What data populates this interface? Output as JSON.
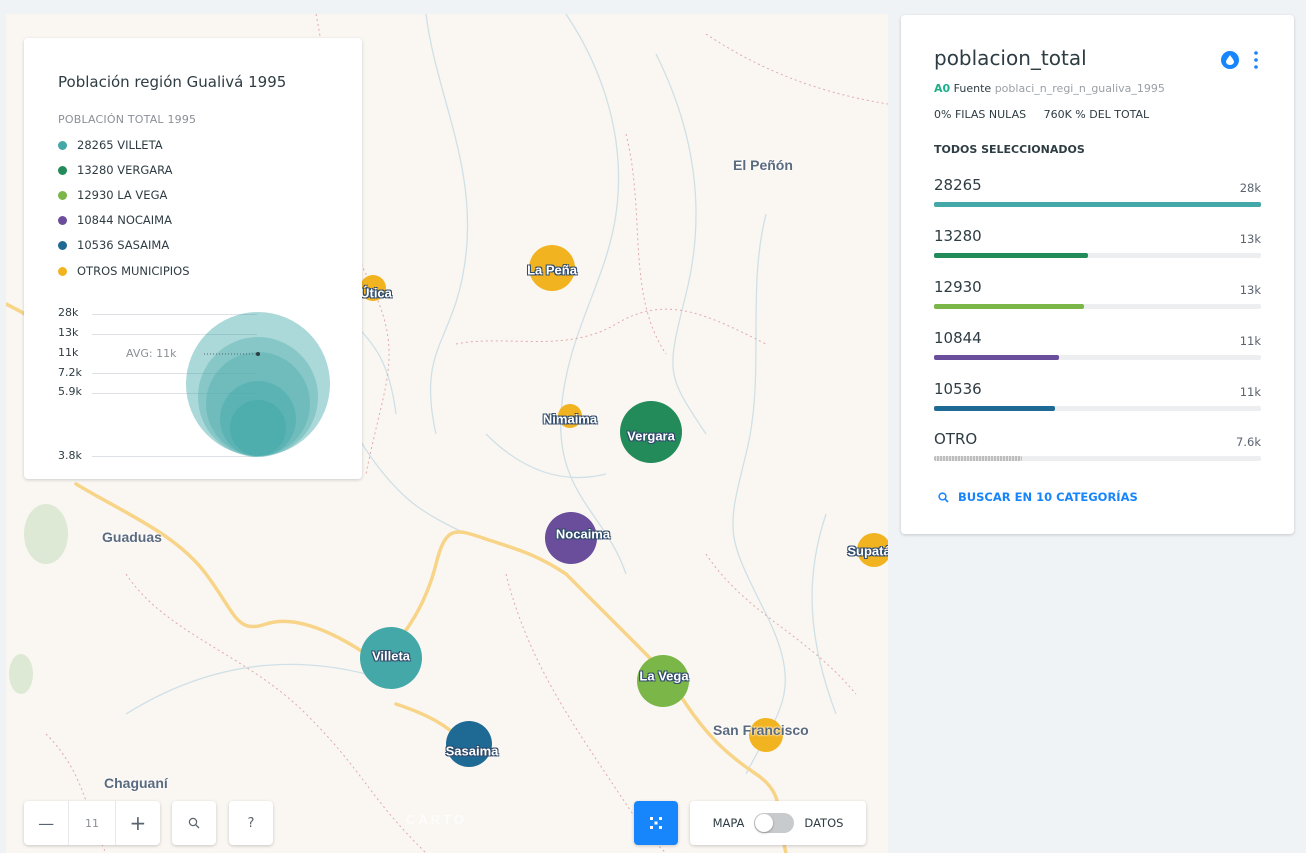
{
  "map": {
    "towns": [
      {
        "name": "El Peñón"
      },
      {
        "name": "Guaduas"
      },
      {
        "name": "Chaguaní"
      },
      {
        "name": "San Francisco"
      }
    ],
    "bubbles": [
      {
        "label": "Vergara",
        "color": "#238b5a",
        "slug": "vergara"
      },
      {
        "label": "Nocaima",
        "color": "#6a4d9b",
        "slug": "nocaima"
      },
      {
        "label": "Villeta",
        "color": "#44a8a8",
        "slug": "villeta"
      },
      {
        "label": "La Vega",
        "color": "#7ab648",
        "slug": "la-vega"
      },
      {
        "label": "Sasaima",
        "color": "#1f6a94",
        "slug": "sasaima"
      },
      {
        "label": "La Peña",
        "color": "#f2b321",
        "slug": "la-pena"
      },
      {
        "label": "Nimaima",
        "color": "#f2b321",
        "slug": "nimaima"
      },
      {
        "label": "Útica",
        "color": "#f2b321",
        "slug": "utica"
      },
      {
        "label": "Supatá",
        "color": "#f2b321",
        "slug": "supata"
      },
      {
        "label": "",
        "color": "#f2b321",
        "slug": "san-francisco"
      }
    ],
    "watermark": "CARTO"
  },
  "legend": {
    "title": "Población región Gualivá 1995",
    "subtitle": "POBLACIÓN TOTAL 1995",
    "items": [
      {
        "label": "28265 VILLETA",
        "color": "#44a8a8"
      },
      {
        "label": "13280 VERGARA",
        "color": "#238b5a"
      },
      {
        "label": "12930 LA VEGA",
        "color": "#7ab648"
      },
      {
        "label": "10844 NOCAIMA",
        "color": "#6a4d9b"
      },
      {
        "label": "10536 SASAIMA",
        "color": "#1f6a94"
      },
      {
        "label": "OTROS MUNICIPIOS",
        "color": "#f2b321"
      }
    ],
    "ticks": [
      "28k",
      "13k",
      "11k",
      "7.2k",
      "5.9k",
      "3.8k"
    ],
    "avg_label": "AVG: 11k"
  },
  "widget": {
    "title": "poblacion_total",
    "source_prefix": "A0",
    "source_label": "Fuente",
    "source_name": "poblaci_n_regi_n_gualiva_1995",
    "nulls": "0% FILAS NULAS",
    "total": "760K % DEL TOTAL",
    "selected": "TODOS SELECCIONADOS",
    "rows": [
      {
        "category": "28265",
        "value": "28k",
        "fraction": 1.0,
        "color": "#44a8a8"
      },
      {
        "category": "13280",
        "value": "13k",
        "fraction": 0.47,
        "color": "#238b5a"
      },
      {
        "category": "12930",
        "value": "13k",
        "fraction": 0.46,
        "color": "#7ab648"
      },
      {
        "category": "10844",
        "value": "11k",
        "fraction": 0.38,
        "color": "#6a4d9b"
      },
      {
        "category": "10536",
        "value": "11k",
        "fraction": 0.37,
        "color": "#1f6a94"
      },
      {
        "category": "OTRO",
        "value": "7.6k",
        "fraction": 0.27,
        "color": "#c7c7c7"
      }
    ],
    "search_label": "BUSCAR EN 10 CATEGORÍAS"
  },
  "controls": {
    "zoom_out": "—",
    "zoom_level": "11",
    "zoom_in": "+",
    "help": "?",
    "toggle_left": "MAPA",
    "toggle_right": "DATOS"
  }
}
